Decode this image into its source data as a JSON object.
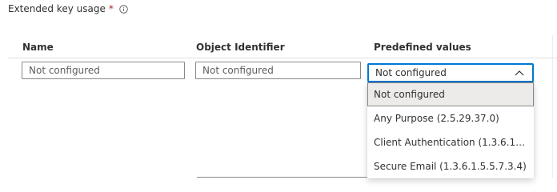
{
  "section": {
    "label": "Extended key usage",
    "required_marker": "*",
    "info_icon": "info-icon"
  },
  "columns": {
    "name": "Name",
    "object_identifier": "Object Identifier",
    "predefined_values": "Predefined values"
  },
  "row": {
    "name_placeholder": "Not configured",
    "oid_placeholder": "Not configured",
    "predefined_selected": "Not configured",
    "chevron_icon": "chevron-up-icon"
  },
  "dropdown": {
    "options": [
      "Not configured",
      "Any Purpose (2.5.29.37.0)",
      "Client Authentication (1.3.6.1.5.5.7.3...",
      "Secure Email (1.3.6.1.5.5.7.3.4)"
    ],
    "selected_index": 0
  },
  "colors": {
    "accent": "#0078d4",
    "required": "#a4262c",
    "selected_option_bg": "#edebe9"
  }
}
